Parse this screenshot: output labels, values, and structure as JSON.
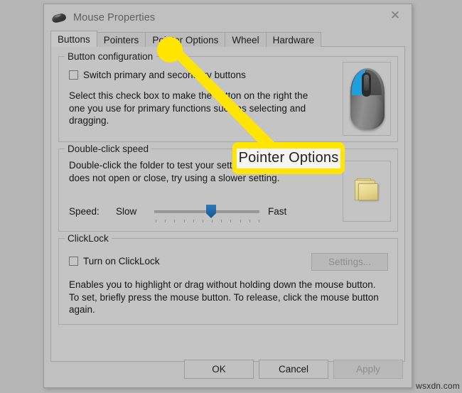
{
  "window": {
    "title": "Mouse Properties",
    "title_icon": "mouse-icon",
    "close_icon": "close-icon"
  },
  "tabs": [
    {
      "label": "Buttons",
      "selected": true
    },
    {
      "label": "Pointers",
      "selected": false
    },
    {
      "label": "Pointer Options",
      "selected": false
    },
    {
      "label": "Wheel",
      "selected": false
    },
    {
      "label": "Hardware",
      "selected": false
    }
  ],
  "button_configuration": {
    "group_label": "Button configuration",
    "checkbox_label": "Switch primary and secondary buttons",
    "checkbox_checked": false,
    "description": "Select this check box to make the button on the right the one you use for primary functions such as selecting and dragging.",
    "preview_icon": "mouse-preview-icon",
    "preview_highlight_color": "#1e9fe0"
  },
  "double_click_speed": {
    "group_label": "Double-click speed",
    "description": "Double-click the folder to test your setting. If the folder does not open or close, try using a slower setting.",
    "speed_label": "Speed:",
    "slow_label": "Slow",
    "fast_label": "Fast",
    "slider_value_percent": 50,
    "slider_thumb_color": "#1f67a8",
    "preview_icon": "folder-icon"
  },
  "click_lock": {
    "group_label": "ClickLock",
    "checkbox_label": "Turn on ClickLock",
    "checkbox_checked": false,
    "settings_button_label": "Settings...",
    "settings_button_enabled": false,
    "description": "Enables you to highlight or drag without holding down the mouse button. To set, briefly press the mouse button. To release, click the mouse button again."
  },
  "footer": {
    "ok_label": "OK",
    "cancel_label": "Cancel",
    "apply_label": "Apply",
    "apply_enabled": false
  },
  "annotation": {
    "label": "Pointer Options",
    "color": "#ffe500",
    "points_to": "Pointer Options tab"
  },
  "watermark": "wsxdn.com"
}
